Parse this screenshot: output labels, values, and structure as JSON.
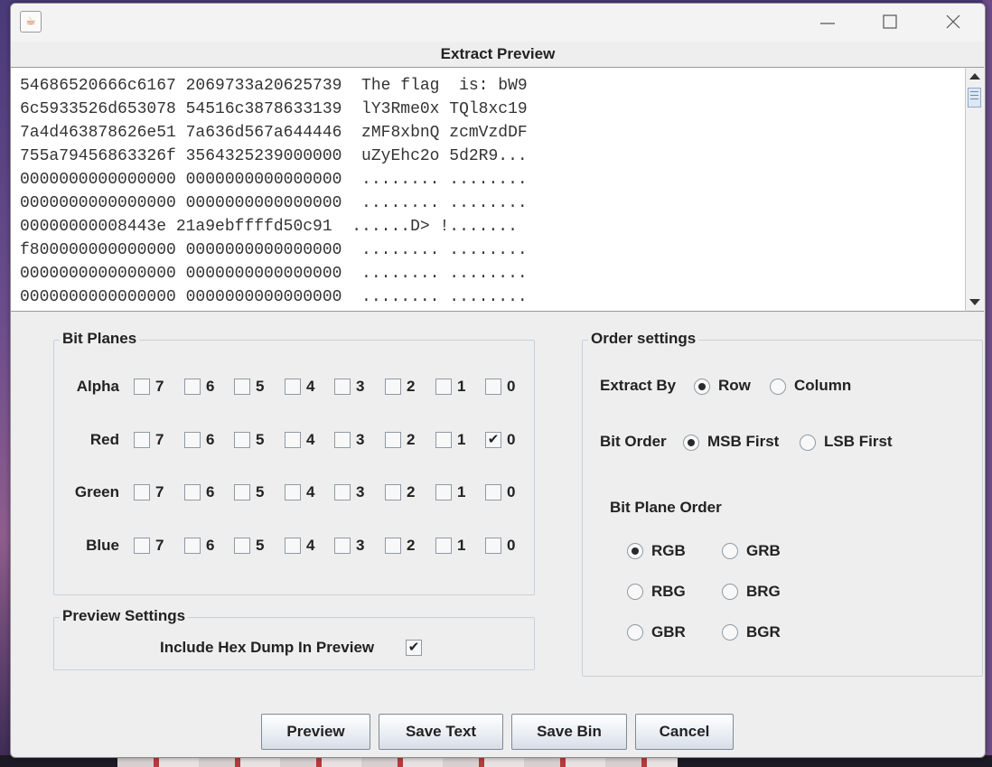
{
  "window": {
    "title": "Extract Preview",
    "icon": "java-cup-icon"
  },
  "preview": {
    "lines": [
      "54686520666c6167 2069733a20625739  The flag  is: bW9",
      "6c5933526d653078 54516c3878633139  lY3Rme0x TQl8xc19",
      "7a4d463878626e51 7a636d567a644446  zMF8xbnQ zcmVzdDF",
      "755a79456863326f 3564325239000000  uZyEhc2o 5d2R9...",
      "0000000000000000 0000000000000000  ........ ........",
      "0000000000000000 0000000000000000  ........ ........",
      "00000000008443e 21a9ebffffd50c91  ......D> !.......",
      "f800000000000000 0000000000000000  ........ ........",
      "0000000000000000 0000000000000000  ........ ........",
      "0000000000000000 0000000000000000  ........ ........"
    ]
  },
  "bit_planes": {
    "title": "Bit Planes",
    "bits": [
      "7",
      "6",
      "5",
      "4",
      "3",
      "2",
      "1",
      "0"
    ],
    "channels": [
      {
        "name": "Alpha",
        "checked": [
          false,
          false,
          false,
          false,
          false,
          false,
          false,
          false
        ]
      },
      {
        "name": "Red",
        "checked": [
          false,
          false,
          false,
          false,
          false,
          false,
          false,
          true
        ]
      },
      {
        "name": "Green",
        "checked": [
          false,
          false,
          false,
          false,
          false,
          false,
          false,
          false
        ]
      },
      {
        "name": "Blue",
        "checked": [
          false,
          false,
          false,
          false,
          false,
          false,
          false,
          false
        ]
      }
    ]
  },
  "preview_settings": {
    "title": "Preview Settings",
    "hex_dump_label": "Include Hex Dump In Preview",
    "hex_dump_checked": true
  },
  "order_settings": {
    "title": "Order settings",
    "extract_by_label": "Extract By",
    "extract_by_options": [
      "Row",
      "Column"
    ],
    "extract_by_selected": "Row",
    "bit_order_label": "Bit Order",
    "bit_order_options": [
      "MSB First",
      "LSB First"
    ],
    "bit_order_selected": "MSB First",
    "plane_order_label": "Bit Plane Order",
    "plane_order_options": [
      "RGB",
      "GRB",
      "RBG",
      "BRG",
      "GBR",
      "BGR"
    ],
    "plane_order_selected": "RGB"
  },
  "buttons": {
    "preview": "Preview",
    "save_text": "Save Text",
    "save_bin": "Save Bin",
    "cancel": "Cancel"
  },
  "check_glyph": "✔"
}
